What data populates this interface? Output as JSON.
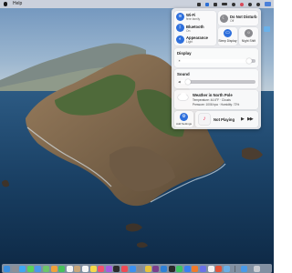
{
  "menubar": {
    "menus": [
      "Help"
    ],
    "status_icons": [
      "box-icon",
      "dropbox-icon",
      "wifi-status-icon",
      "battery-icon",
      "bluetooth-icon",
      "heart-icon",
      "spotlight-icon",
      "user-icon",
      "control-center-icon"
    ]
  },
  "control_center": {
    "wifi": {
      "title": "Wi-Fi",
      "subtitle": "fere family",
      "icon": "wifi-icon"
    },
    "bluetooth": {
      "title": "Bluetooth",
      "subtitle": "On",
      "icon": "bluetooth-icon"
    },
    "appearance": {
      "title": "Appearance",
      "subtitle": "Light",
      "icon": "appearance-icon"
    },
    "do_not_disturb": {
      "title": "Do Not Disturb",
      "subtitle": "Off",
      "icon": "moon-icon"
    },
    "sleep_display": {
      "label": "Sleep Display",
      "icon": "display-icon"
    },
    "night_shift": {
      "label": "Night Shift",
      "icon": "night-shift-icon"
    },
    "display": {
      "label": "Display",
      "level": 0.95
    },
    "sound": {
      "label": "Sound",
      "level": 0.18
    },
    "weather": {
      "title": "Weather in North Pole",
      "line1": "Temperature: 44.6°F · Clouds",
      "line2": "Pressure: 1006 hpa · Humidity: 72%",
      "icon": "cloud-icon"
    },
    "add_settings": {
      "label": "Add Settings",
      "icon": "gear-icon"
    },
    "music": {
      "label": "Not Playing",
      "play": "▶",
      "forward": "▶▶",
      "icon": "music-icon"
    }
  },
  "dock": {
    "apps": [
      {
        "name": "finder",
        "color": "#3b8fe0"
      },
      {
        "name": "launchpad",
        "color": "#8d8f96"
      },
      {
        "name": "safari",
        "color": "#3fa6f2"
      },
      {
        "name": "messages",
        "color": "#5ad15a"
      },
      {
        "name": "mail",
        "color": "#4c97ea"
      },
      {
        "name": "maps",
        "color": "#6fc46a"
      },
      {
        "name": "photos",
        "color": "#f0a13a"
      },
      {
        "name": "facetime",
        "color": "#47c15a"
      },
      {
        "name": "calendar",
        "color": "#f4f4f4"
      },
      {
        "name": "contacts",
        "color": "#c8a67a"
      },
      {
        "name": "reminders",
        "color": "#f6f6f6"
      },
      {
        "name": "notes",
        "color": "#f5d94a"
      },
      {
        "name": "music",
        "color": "#f0526f"
      },
      {
        "name": "podcasts",
        "color": "#a55ce0"
      },
      {
        "name": "tv",
        "color": "#2b2b2b"
      },
      {
        "name": "news",
        "color": "#ef4a53"
      },
      {
        "name": "app-store",
        "color": "#3b8ff0"
      },
      {
        "name": "system-preferences",
        "color": "#8a8a90"
      },
      {
        "name": "chrome",
        "color": "#e6c23c"
      },
      {
        "name": "slack",
        "color": "#7a3f8c"
      },
      {
        "name": "vscode",
        "color": "#2f80d6"
      },
      {
        "name": "terminal",
        "color": "#2a2a2a"
      },
      {
        "name": "spotify",
        "color": "#3ec463"
      },
      {
        "name": "zoom",
        "color": "#3a7ff0"
      },
      {
        "name": "firefox",
        "color": "#f07a2a"
      },
      {
        "name": "discord",
        "color": "#6a72e8"
      },
      {
        "name": "notion",
        "color": "#f2f2f2"
      },
      {
        "name": "figma",
        "color": "#e2553a"
      },
      {
        "name": "preview",
        "color": "#6aaee6"
      },
      {
        "name": "downloads",
        "color": "#4a9ae8"
      },
      {
        "name": "trash",
        "color": "#c9ccd2"
      }
    ]
  }
}
